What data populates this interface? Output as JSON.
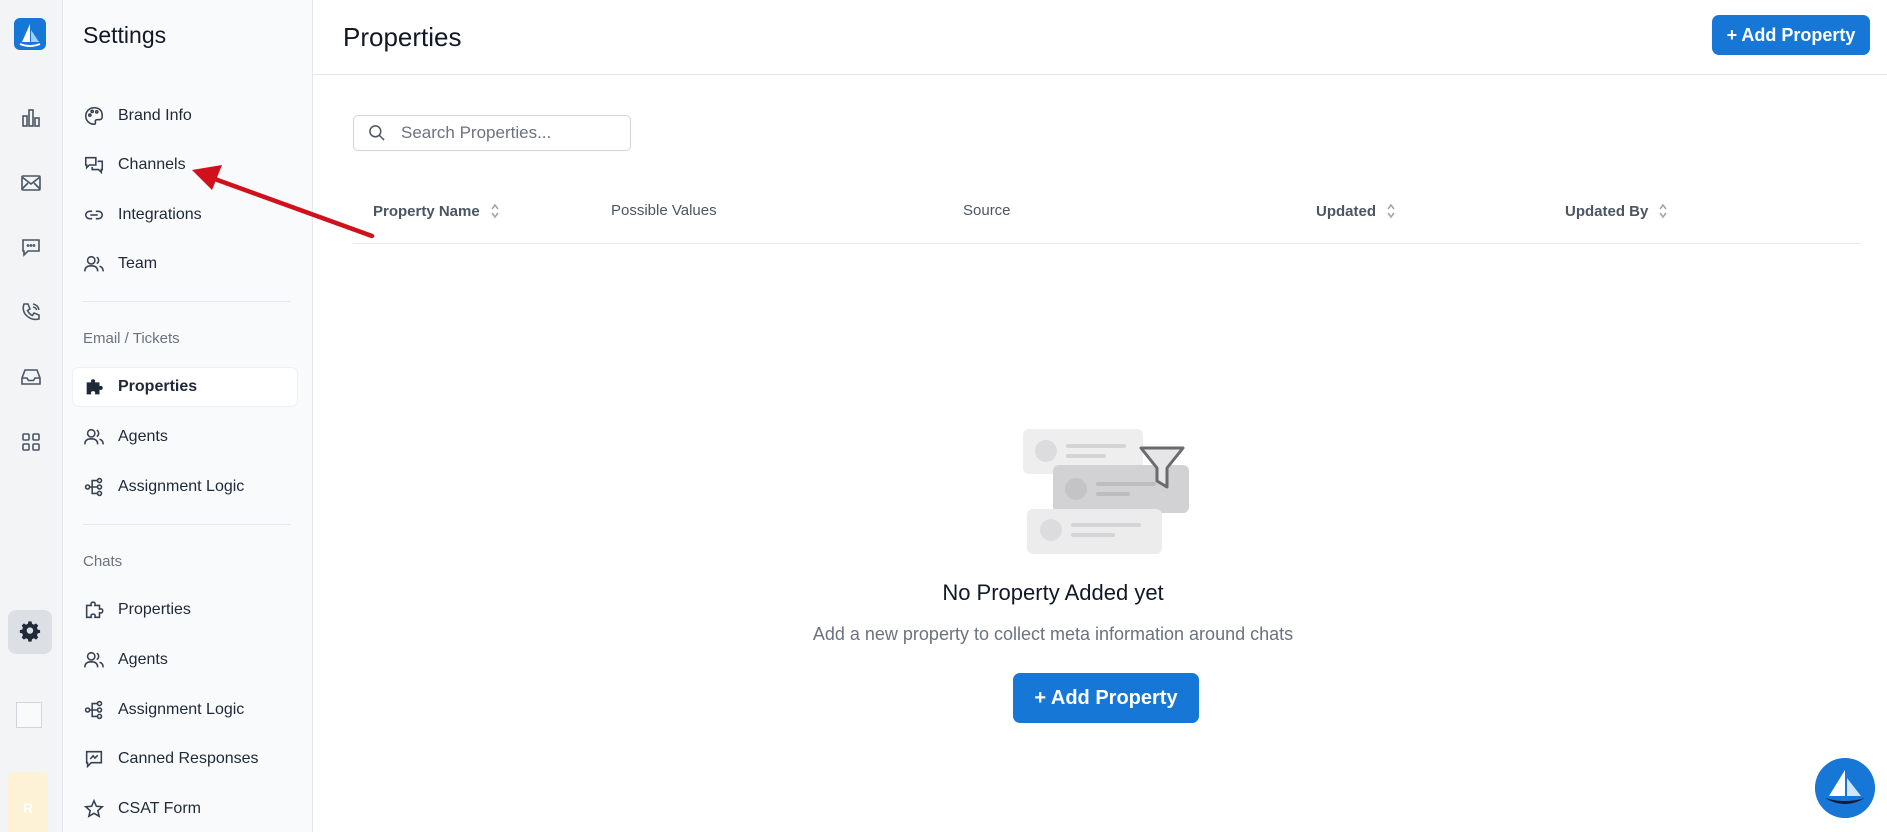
{
  "sidebar": {
    "title": "Settings",
    "general": [
      {
        "label": "Brand Info",
        "icon": "palette-icon"
      },
      {
        "label": "Channels",
        "icon": "chat-bubbles-icon"
      },
      {
        "label": "Integrations",
        "icon": "link-icon"
      },
      {
        "label": "Team",
        "icon": "users-icon"
      }
    ],
    "email_section": "Email / Tickets",
    "email": [
      {
        "label": "Properties",
        "icon": "puzzle-icon",
        "active": true
      },
      {
        "label": "Agents",
        "icon": "users-icon"
      },
      {
        "label": "Assignment Logic",
        "icon": "flow-icon"
      }
    ],
    "chats_section": "Chats",
    "chats": [
      {
        "label": "Properties",
        "icon": "puzzle-icon"
      },
      {
        "label": "Agents",
        "icon": "users-icon"
      },
      {
        "label": "Assignment Logic",
        "icon": "flow-icon"
      },
      {
        "label": "Canned Responses",
        "icon": "canned-response-icon"
      },
      {
        "label": "CSAT Form",
        "icon": "star-icon"
      }
    ]
  },
  "rail": {
    "avatar_initial": "R"
  },
  "header": {
    "title": "Properties",
    "add_button": "+ Add Property"
  },
  "search": {
    "placeholder": "Search Properties..."
  },
  "table": {
    "columns": [
      "Property Name",
      "Possible Values",
      "Source",
      "Updated",
      "Updated By"
    ]
  },
  "empty_state": {
    "title": "No Property Added yet",
    "description": "Add a new property to collect meta information around chats",
    "button": "+ Add Property"
  },
  "colors": {
    "primary": "#1677d6",
    "annotation_arrow": "#d0101a"
  }
}
